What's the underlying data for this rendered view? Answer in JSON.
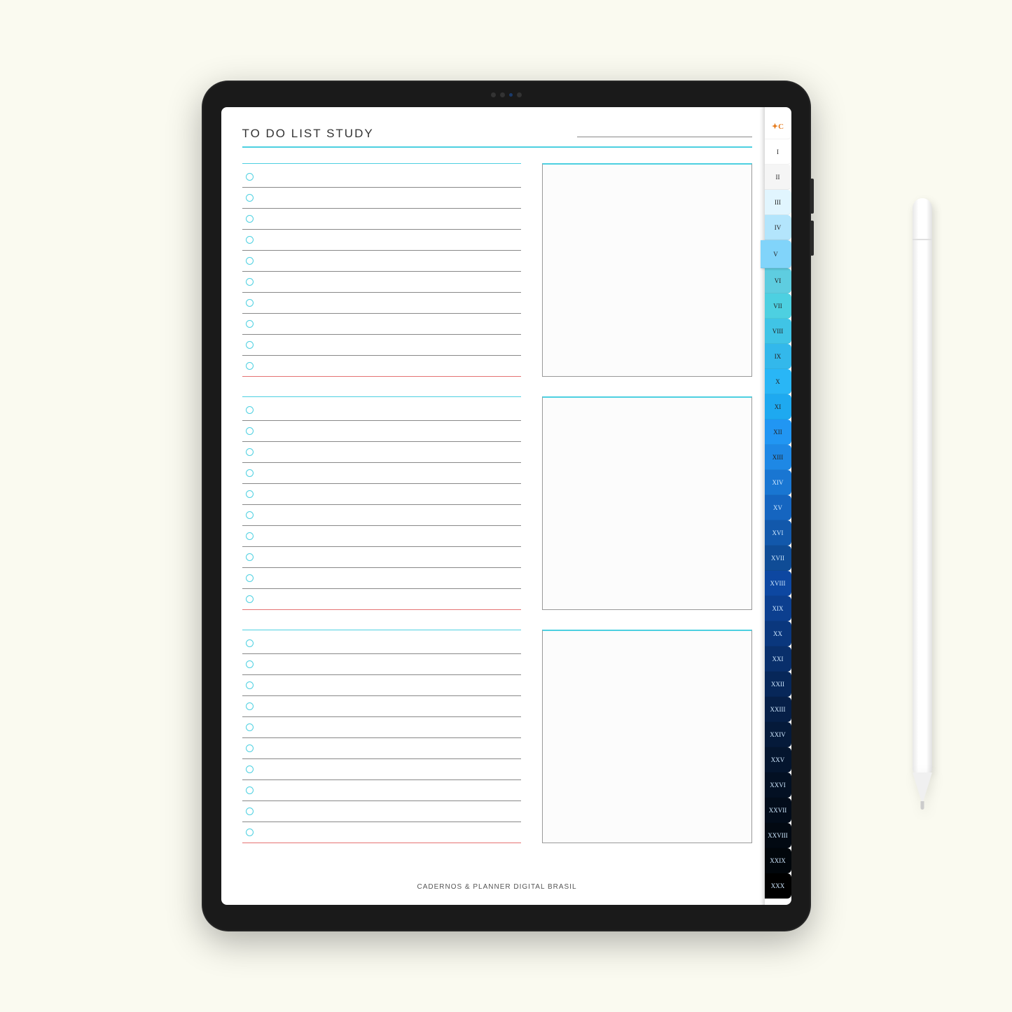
{
  "page": {
    "title": "TO DO LIST STUDY",
    "footer": "CADERNOS & PLANNER DIGITAL BRASIL"
  },
  "sections": [
    {
      "items_count": 10
    },
    {
      "items_count": 10
    },
    {
      "items_count": 10
    }
  ],
  "tabs": [
    {
      "label": "✦C",
      "color": "#ffffff",
      "is_logo": true,
      "active": false
    },
    {
      "label": "I",
      "color": "#ffffff",
      "active": false
    },
    {
      "label": "II",
      "color": "#f5f5f5",
      "active": false
    },
    {
      "label": "III",
      "color": "#e1f5fe",
      "active": false
    },
    {
      "label": "IV",
      "color": "#b3e5fc",
      "active": false
    },
    {
      "label": "V",
      "color": "#81d4fa",
      "active": true
    },
    {
      "label": "VI",
      "color": "#5ecde0",
      "active": false
    },
    {
      "label": "VII",
      "color": "#4dd0e1",
      "active": false
    },
    {
      "label": "VIII",
      "color": "#40c4e6",
      "active": false
    },
    {
      "label": "IX",
      "color": "#33b8eb",
      "active": false
    },
    {
      "label": "X",
      "color": "#29b6f6",
      "active": false
    },
    {
      "label": "XI",
      "color": "#1ea9f0",
      "active": false
    },
    {
      "label": "XII",
      "color": "#2196f3",
      "active": false
    },
    {
      "label": "XIII",
      "color": "#1e88e5",
      "active": false
    },
    {
      "label": "XIV",
      "color": "#1976d2",
      "active": false
    },
    {
      "label": "XV",
      "color": "#1565c0",
      "active": false
    },
    {
      "label": "XVI",
      "color": "#1258ab",
      "active": false
    },
    {
      "label": "XVII",
      "color": "#0f4c96",
      "active": false
    },
    {
      "label": "XVIII",
      "color": "#0d47a1",
      "active": false
    },
    {
      "label": "XIX",
      "color": "#0c3f8f",
      "active": false
    },
    {
      "label": "XX",
      "color": "#0a377d",
      "active": false
    },
    {
      "label": "XXI",
      "color": "#092f6b",
      "active": false
    },
    {
      "label": "XXII",
      "color": "#072759",
      "active": false
    },
    {
      "label": "XXIII",
      "color": "#061f47",
      "active": false
    },
    {
      "label": "XXIV",
      "color": "#051a3a",
      "active": false
    },
    {
      "label": "XXV",
      "color": "#04152e",
      "active": false
    },
    {
      "label": "XXVI",
      "color": "#031023",
      "active": false
    },
    {
      "label": "XXVII",
      "color": "#020c1a",
      "active": false
    },
    {
      "label": "XXVIII",
      "color": "#020912",
      "active": false
    },
    {
      "label": "XXIX",
      "color": "#01060b",
      "active": false
    },
    {
      "label": "XXX",
      "color": "#000000",
      "active": false
    }
  ]
}
